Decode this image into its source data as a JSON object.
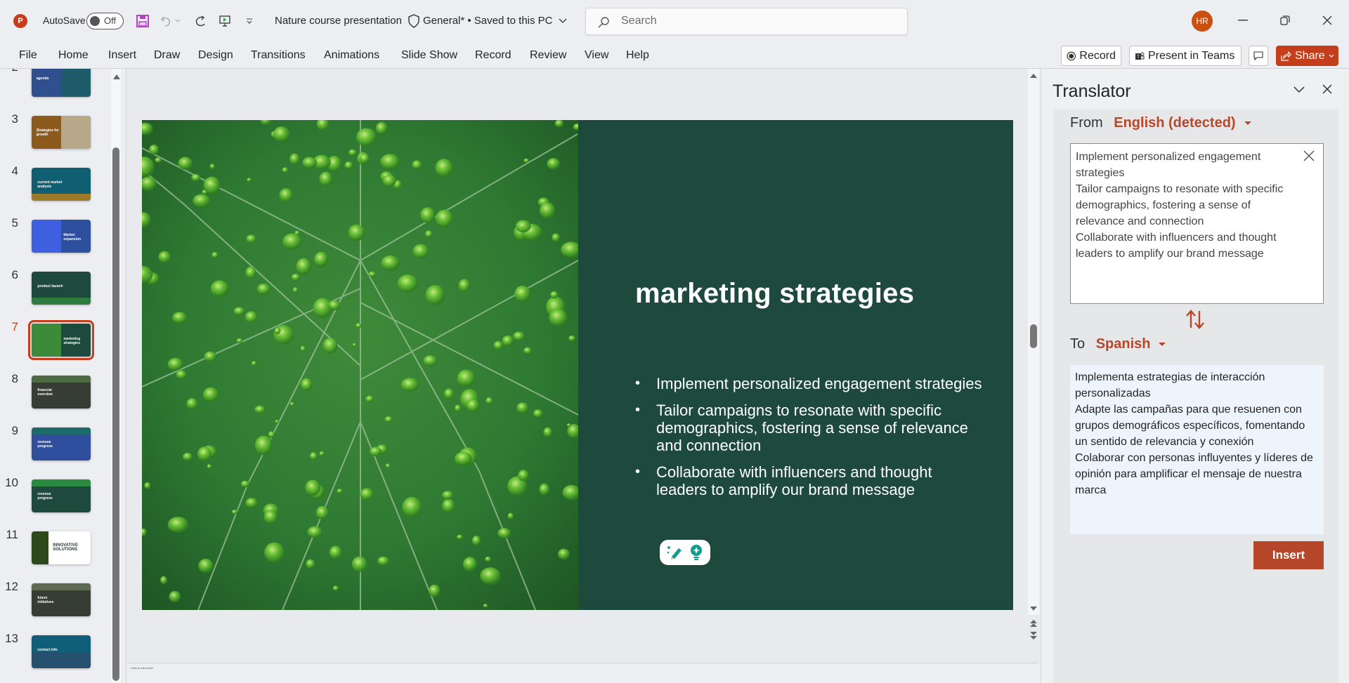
{
  "titlebar": {
    "app_logo": "P",
    "autosave_label": "AutoSave",
    "autosave_state": "Off",
    "document_title": "Nature course presentation",
    "sensitivity_label": "General*",
    "save_status": "• Saved to this PC",
    "search_placeholder": "Search",
    "user_initials": "HR",
    "icons": [
      "save-icon",
      "undo-icon",
      "redo-icon",
      "start-slideshow-icon",
      "customize-toolbar-icon",
      "shield-icon",
      "search-icon",
      "minimize-icon",
      "restore-icon",
      "close-icon"
    ]
  },
  "ribbon": {
    "tabs": [
      "File",
      "Home",
      "Insert",
      "Draw",
      "Design",
      "Transitions",
      "Animations",
      "Slide Show",
      "Record",
      "Review",
      "View",
      "Help"
    ],
    "record_label": "Record",
    "present_teams_label": "Present in Teams",
    "share_label": "Share"
  },
  "thumbnails": {
    "active_slide": 7,
    "slides": [
      {
        "number": "2",
        "title": "agenda",
        "bg": "#2f4f8f"
      },
      {
        "number": "3",
        "title": "Strategies for growth",
        "bg": "#8d5a1e"
      },
      {
        "number": "4",
        "title": "current market analysis",
        "bg": "#0f5e72"
      },
      {
        "number": "5",
        "title": "Market expansion",
        "bg": "#2d4f9e"
      },
      {
        "number": "6",
        "title": "product launch",
        "bg": "#1e4a3d"
      },
      {
        "number": "7",
        "title": "marketing strategies",
        "bg": "#1e4a3d"
      },
      {
        "number": "8",
        "title": "financial overview",
        "bg": "#363d33"
      },
      {
        "number": "9",
        "title": "revenue progress",
        "bg": "#2f4f9e"
      },
      {
        "number": "10",
        "title": "revenue progress",
        "bg": "#1e4a3d"
      },
      {
        "number": "11",
        "title": "INNOVATIVE SOLUTIONS",
        "bg": "#ffffff"
      },
      {
        "number": "12",
        "title": "future initiatives",
        "bg": "#363d33"
      },
      {
        "number": "13",
        "title": "contact info",
        "bg": "#0f5e7a"
      }
    ]
  },
  "slide": {
    "title": "marketing strategies",
    "bullets": [
      "Implement personalized engagement strategies",
      "Tailor campaigns to resonate with specific demographics, fostering a sense of relevance and connection",
      "Collaborate with influencers and thought leaders to amplify our brand message"
    ],
    "image_description": "leaf-with-water-droplets",
    "bg_color": "#1e4a3d"
  },
  "notes": {
    "placeholder": "Click to add notes"
  },
  "translator": {
    "title": "Translator",
    "from_label": "From",
    "from_language": "English (detected)",
    "source_lines": [
      "Implement personalized engagement strategies",
      "Tailor campaigns to resonate with specific demographics, fostering a sense of relevance and connection",
      "Collaborate with influencers and thought leaders to amplify our brand message"
    ],
    "to_label": "To",
    "to_language": "Spanish",
    "target_lines": [
      "Implementa estrategias de interacción personalizadas",
      "Adapte las campañas para que resuenen con grupos demográficos específicos, fomentando un sentido de relevancia y conexión",
      "Colaborar con personas influyentes y líderes de opinión para amplificar el mensaje de nuestra marca"
    ],
    "insert_label": "Insert",
    "accent_color": "#b7472a"
  }
}
